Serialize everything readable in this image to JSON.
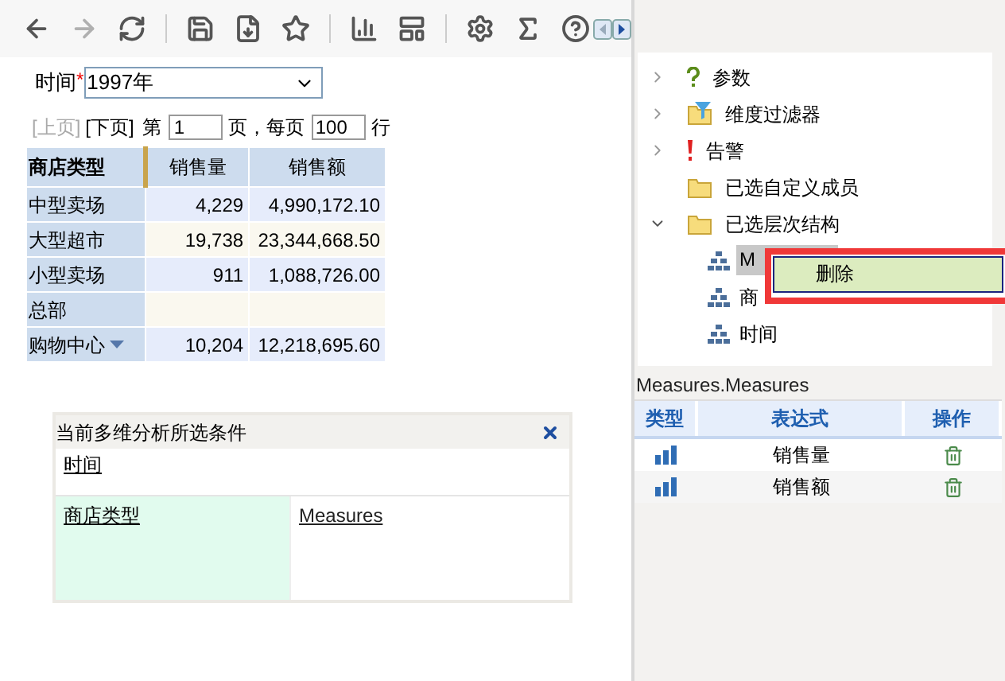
{
  "toolbar": {
    "buttons": [
      {
        "kind": "back",
        "disabled": false
      },
      {
        "kind": "forward",
        "disabled": true
      },
      {
        "kind": "refresh",
        "disabled": false
      },
      {
        "kind": "save",
        "disabled": false
      },
      {
        "kind": "save-as",
        "disabled": false
      },
      {
        "kind": "favorite",
        "disabled": false
      },
      {
        "kind": "chart",
        "disabled": false
      },
      {
        "kind": "layout",
        "disabled": false
      },
      {
        "kind": "settings",
        "disabled": false
      },
      {
        "kind": "sum",
        "disabled": false
      },
      {
        "kind": "help",
        "disabled": false
      }
    ]
  },
  "filter": {
    "label": "时间",
    "required_mark": "*",
    "value": "1997年"
  },
  "pager": {
    "prev": {
      "label": "[上页]",
      "disabled": true
    },
    "next": {
      "label": "[下页]",
      "disabled": false
    },
    "before_page": "第",
    "page": "1",
    "between": "页，每页",
    "per_page": "100",
    "after": "行"
  },
  "table": {
    "columns": [
      "商店类型",
      "销售量",
      "销售额"
    ],
    "rows": [
      {
        "cells": [
          "中型卖场",
          "4,229",
          "4,990,172.10"
        ],
        "has_menu": false
      },
      {
        "cells": [
          "大型超市",
          "19,738",
          "23,344,668.50"
        ],
        "has_menu": false
      },
      {
        "cells": [
          "小型卖场",
          "911",
          "1,088,726.00"
        ],
        "has_menu": false
      },
      {
        "cells": [
          "总部"
        ],
        "has_menu": false
      },
      {
        "cells": [
          "购物中心",
          "10,204",
          "12,218,695.60"
        ],
        "has_menu": true
      }
    ]
  },
  "conditions": {
    "title": "当前多维分析所选条件",
    "top": "时间",
    "rows_dimension": "商店类型",
    "columns_dimension": "Measures"
  },
  "tree": {
    "items": [
      {
        "kind": "parameter",
        "label": "参数",
        "expanded": false
      },
      {
        "kind": "filter",
        "label": "维度过滤器",
        "expanded": false
      },
      {
        "kind": "alert",
        "label": "告警",
        "expanded": false
      },
      {
        "kind": "folder",
        "label": "已选自定义成员"
      },
      {
        "kind": "folder",
        "label": "已选层次结构",
        "expanded": true,
        "children": [
          {
            "label": "M",
            "selected": true
          },
          {
            "label": "商",
            "selected": false
          },
          {
            "label": "时间",
            "selected": false
          }
        ]
      }
    ]
  },
  "context_menu": {
    "items": [
      "删除"
    ]
  },
  "measures": {
    "title": "Measures.Measures",
    "columns": [
      "类型",
      "表达式",
      "操作"
    ],
    "rows": [
      {
        "expression": "销售量"
      },
      {
        "expression": "销售额"
      }
    ]
  }
}
